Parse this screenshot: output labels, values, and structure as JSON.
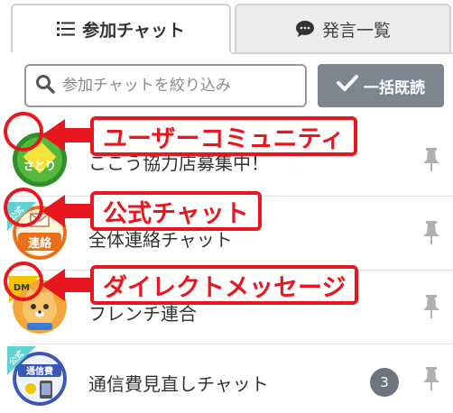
{
  "tabs": [
    {
      "label": "参加チャット",
      "icon": "list-icon",
      "active": true
    },
    {
      "label": "発言一覧",
      "icon": "speech-bubble-icon",
      "active": false
    }
  ],
  "search": {
    "placeholder": "参加チャットを絞り込み",
    "icon": "search-icon"
  },
  "bulk_read_button": {
    "label": "一括既読",
    "icon": "checkmark-icon"
  },
  "chats": [
    {
      "title": "ここう協力店募集中！",
      "avatar_label": "さとり",
      "tag": "",
      "pinned": true
    },
    {
      "title": "全体連絡チャット",
      "avatar_label": "連絡",
      "tag": "公式",
      "pinned": true
    },
    {
      "title": "フレンチ連合",
      "avatar_label": "",
      "tag": "DM",
      "pinned": true
    },
    {
      "title": "通信費見直しチャット",
      "avatar_label": "通信費",
      "tag": "公式",
      "unread": "3",
      "pinned": true
    }
  ],
  "callouts": [
    {
      "label": "ユーザーコミュニティ"
    },
    {
      "label": "公式チャット"
    },
    {
      "label": "ダイレクトメッセージ"
    }
  ],
  "colors": {
    "annotation": "#e8161e",
    "official_tag": "#5fd3d3",
    "dm_tag": "#f5c400",
    "button": "#7c8590"
  }
}
